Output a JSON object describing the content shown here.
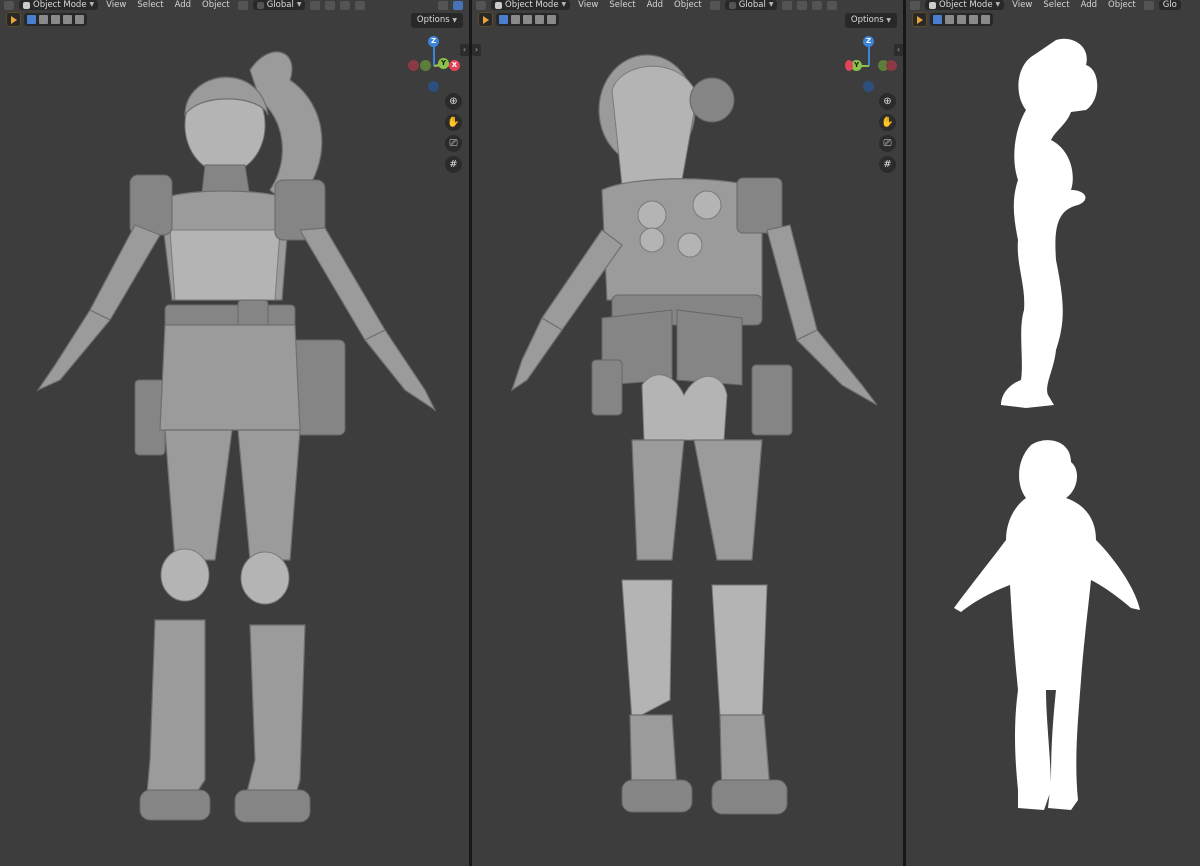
{
  "viewports": [
    {
      "name": "front",
      "header": {
        "mode": "Object Mode",
        "menus": [
          "View",
          "Select",
          "Add",
          "Object"
        ],
        "transform": "Global"
      },
      "options_label": "Options",
      "gizmo": {
        "z": "Z",
        "y": "Y",
        "x": "X"
      }
    },
    {
      "name": "back",
      "header": {
        "mode": "Object Mode",
        "menus": [
          "View",
          "Select",
          "Add",
          "Object"
        ],
        "transform": "Global"
      },
      "options_label": "Options",
      "gizmo": {
        "z": "Z",
        "y": "Y"
      }
    },
    {
      "name": "silhouette",
      "header": {
        "mode": "Object Mode",
        "menus": [
          "View",
          "Select",
          "Add",
          "Object"
        ],
        "transform": "Glo"
      }
    }
  ],
  "colors": {
    "viewport_bg": "#3d3d3d",
    "x_axis": "#e04458",
    "y_axis": "#8bc34a",
    "z_axis": "#3b84d8",
    "model": "#9b9b9b",
    "silhouette": "#ffffff",
    "tool_accent": "#e8a33a"
  },
  "nav_icons": [
    "zoom-icon",
    "hand-pan-icon",
    "camera-icon",
    "grid-icon"
  ]
}
